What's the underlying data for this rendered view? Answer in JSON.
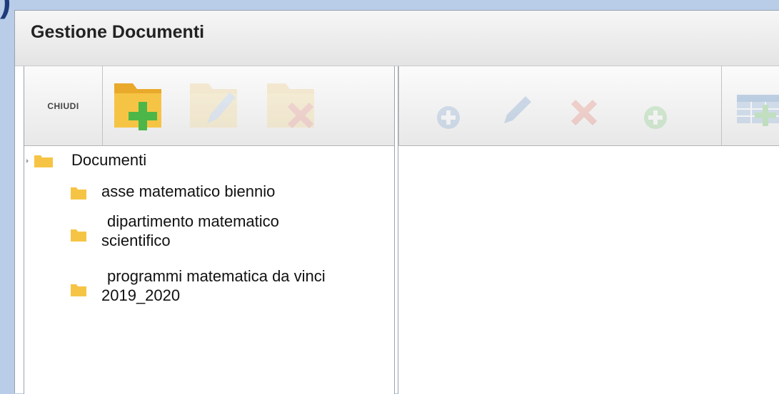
{
  "window": {
    "title": "Gestione Documenti"
  },
  "left_toolbar": {
    "close_label": "CHIUDI",
    "buttons": [
      {
        "name": "new-folder",
        "icon": "folder-add-icon",
        "enabled": true
      },
      {
        "name": "edit-folder",
        "icon": "folder-edit-icon",
        "enabled": false
      },
      {
        "name": "delete-folder",
        "icon": "folder-delete-icon",
        "enabled": false
      }
    ]
  },
  "right_toolbar": {
    "buttons": [
      {
        "name": "add-document",
        "icon": "add-icon",
        "enabled": false
      },
      {
        "name": "edit-document",
        "icon": "pencil-icon",
        "enabled": false
      },
      {
        "name": "delete-document",
        "icon": "delete-icon",
        "enabled": false
      },
      {
        "name": "add-item",
        "icon": "add-green-icon",
        "enabled": false
      },
      {
        "name": "grid-add",
        "icon": "table-add-icon",
        "enabled": false
      }
    ]
  },
  "tree": {
    "root": {
      "label": "Documenti"
    },
    "children": [
      {
        "line1": "asse matematico biennio",
        "line2": ""
      },
      {
        "line1": "dipartimento matematico",
        "line2": "scientifico"
      },
      {
        "line1": "programmi matematica da vinci",
        "line2": "2019_2020"
      }
    ]
  },
  "colors": {
    "folder": "#f6c445",
    "folder_dark": "#e9a92a",
    "add_green": "#4cb748",
    "delete_red": "#e0452f",
    "page_bg": "#b9cde8"
  }
}
